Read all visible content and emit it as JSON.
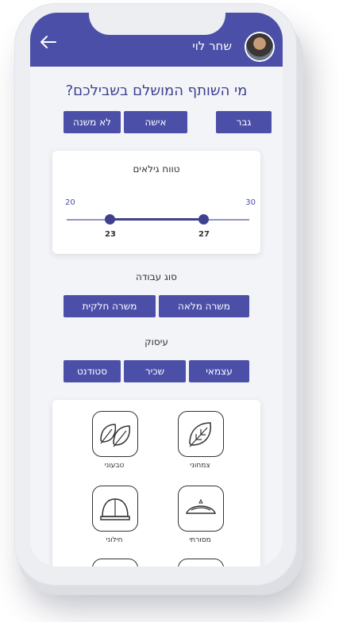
{
  "header": {
    "user_name": "שחר לוי"
  },
  "title": "מי השותף המושלם בשבילכם?",
  "gender": [
    "גבר",
    "אישה",
    "לא משנה"
  ],
  "age_range": {
    "title": "טווח גילאים",
    "min": 20,
    "max": 30,
    "from": 23,
    "to": 27
  },
  "job_type": {
    "title": "סוג עבודה",
    "options": [
      "משרה מלאה",
      "משרה חלקית"
    ]
  },
  "occupation": {
    "title": "עיסוק",
    "options": [
      "עצמאי",
      "שכיר",
      "סטודנט"
    ]
  },
  "lifestyle": [
    {
      "label": "צמחוני",
      "icon": "leaf-icon"
    },
    {
      "label": "טבעוני",
      "icon": "leaves-icon"
    },
    {
      "label": "מסורתי",
      "icon": "kippah-icon"
    },
    {
      "label": "חילוני",
      "icon": "cap-icon"
    }
  ],
  "colors": {
    "accent": "#4b4fa8",
    "title": "#3e418f"
  }
}
